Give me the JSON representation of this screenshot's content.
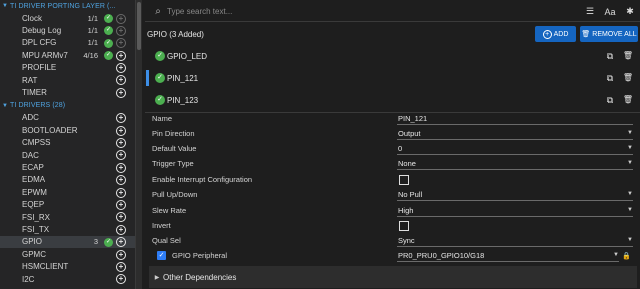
{
  "sidebar": {
    "porting_section": "TI DRIVER PORTING LAYER (...",
    "porting_items": [
      {
        "label": "Clock",
        "count": "1/1",
        "check": true,
        "plus_dim": true
      },
      {
        "label": "Debug Log",
        "count": "1/1",
        "check": true,
        "plus_dim": true
      },
      {
        "label": "DPL CFG",
        "count": "1/1",
        "check": true,
        "plus_dim": true
      },
      {
        "label": "MPU ARMv7",
        "count": "4/16",
        "check": true,
        "plus_dim": false
      },
      {
        "label": "PROFILE",
        "count": "",
        "check": false,
        "plus_dim": false
      },
      {
        "label": "RAT",
        "count": "",
        "check": false,
        "plus_dim": false
      },
      {
        "label": "TIMER",
        "count": "",
        "check": false,
        "plus_dim": false
      }
    ],
    "drivers_section": "TI DRIVERS (28)",
    "driver_items": [
      {
        "label": "ADC",
        "count": "",
        "check": false,
        "selected": false
      },
      {
        "label": "BOOTLOADER",
        "count": "",
        "check": false,
        "selected": false
      },
      {
        "label": "CMPSS",
        "count": "",
        "check": false,
        "selected": false
      },
      {
        "label": "DAC",
        "count": "",
        "check": false,
        "selected": false
      },
      {
        "label": "ECAP",
        "count": "",
        "check": false,
        "selected": false
      },
      {
        "label": "EDMA",
        "count": "",
        "check": false,
        "selected": false
      },
      {
        "label": "EPWM",
        "count": "",
        "check": false,
        "selected": false
      },
      {
        "label": "EQEP",
        "count": "",
        "check": false,
        "selected": false
      },
      {
        "label": "FSI_RX",
        "count": "",
        "check": false,
        "selected": false
      },
      {
        "label": "FSI_TX",
        "count": "",
        "check": false,
        "selected": false
      },
      {
        "label": "GPIO",
        "count": "3",
        "check": true,
        "selected": true
      },
      {
        "label": "GPMC",
        "count": "",
        "check": false,
        "selected": false
      },
      {
        "label": "HSMCLIENT",
        "count": "",
        "check": false,
        "selected": false
      },
      {
        "label": "I2C",
        "count": "",
        "check": false,
        "selected": false
      }
    ]
  },
  "search": {
    "placeholder": "Type search text...",
    "font_tool": "Aa"
  },
  "header": {
    "title": "GPIO (3 Added)",
    "add_label": "ADD",
    "remove_all_label": "REMOVE ALL"
  },
  "instances": [
    {
      "name": "GPIO_LED",
      "active": false
    },
    {
      "name": "PIN_121",
      "active": true
    },
    {
      "name": "PIN_123",
      "active": false
    }
  ],
  "properties": {
    "name_label": "Name",
    "name_value": "PIN_121",
    "direction_label": "Pin Direction",
    "direction_value": "Output",
    "default_label": "Default Value",
    "default_value": "0",
    "trigger_label": "Trigger Type",
    "trigger_value": "None",
    "interrupt_label": "Enable Interrupt Configuration",
    "pull_label": "Pull Up/Down",
    "pull_value": "No Pull",
    "slew_label": "Slew Rate",
    "slew_value": "High",
    "invert_label": "Invert",
    "qual_label": "Qual Sel",
    "qual_value": "Sync",
    "peripheral_label": "GPIO Peripheral",
    "peripheral_value": "PR0_PRU0_GPIO10/G18"
  },
  "other_dependencies": "Other Dependencies",
  "colors": {
    "accent": "#1565c0",
    "check": "#4caf50",
    "section": "#4fa3e0"
  }
}
